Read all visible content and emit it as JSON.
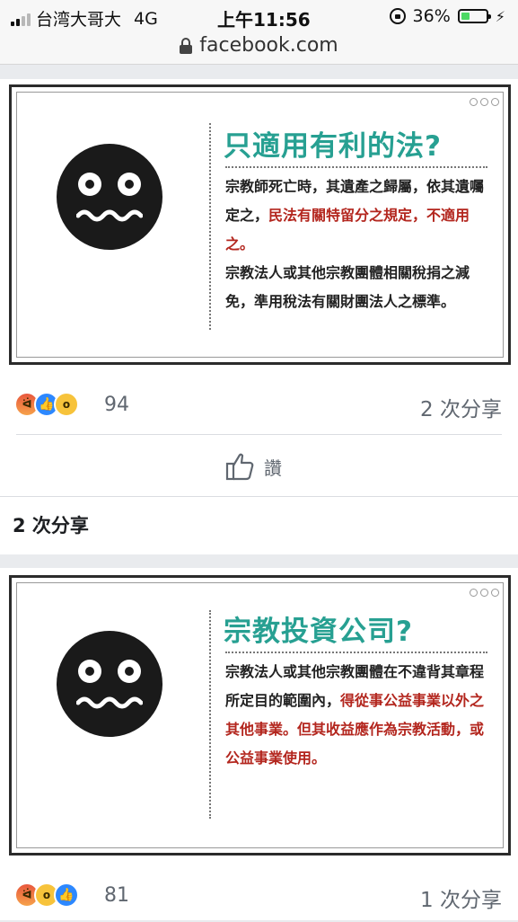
{
  "status_bar": {
    "carrier": "台湾大哥大",
    "network": "4G",
    "time": "上午11:56",
    "battery_percent": "36%",
    "battery_level": 0.36,
    "signal_bars": 2
  },
  "browser": {
    "url": "facebook.com"
  },
  "posts": [
    {
      "slide": {
        "title": "只適用有利的法?",
        "body_parts": [
          {
            "text": "宗教師死亡時，其遺產之歸屬，依其遺囑定之，",
            "color": "#222222"
          },
          {
            "text": "民法有關特留分之規定，不適用之。",
            "color": "#b3261e"
          },
          {
            "text": "宗教法人或其他宗教團體相關稅捐之減免，準用稅法有關財團法人之標準。",
            "color": "#222222"
          }
        ]
      },
      "reactions": [
        "angry",
        "like",
        "wow"
      ],
      "reaction_count": "94",
      "share_count": "2 次分享",
      "like_label": "讚",
      "shares_header": "2 次分享"
    },
    {
      "slide": {
        "title": "宗教投資公司?",
        "body_parts": [
          {
            "text": "宗教法人或其他宗教團體在不違背其章程所定目的範圍內，",
            "color": "#222222"
          },
          {
            "text": "得從事公益事業以外之其他事業。但其收益應作為宗教活動，或公益事業使用。",
            "color": "#b3261e"
          }
        ]
      },
      "reactions": [
        "angry",
        "wow",
        "like"
      ],
      "reaction_count": "81",
      "share_count": "1 次分享"
    }
  ],
  "colors": {
    "accent_teal": "#27a092",
    "highlight_red": "#b3261e",
    "feed_background": "#e9ebee"
  }
}
